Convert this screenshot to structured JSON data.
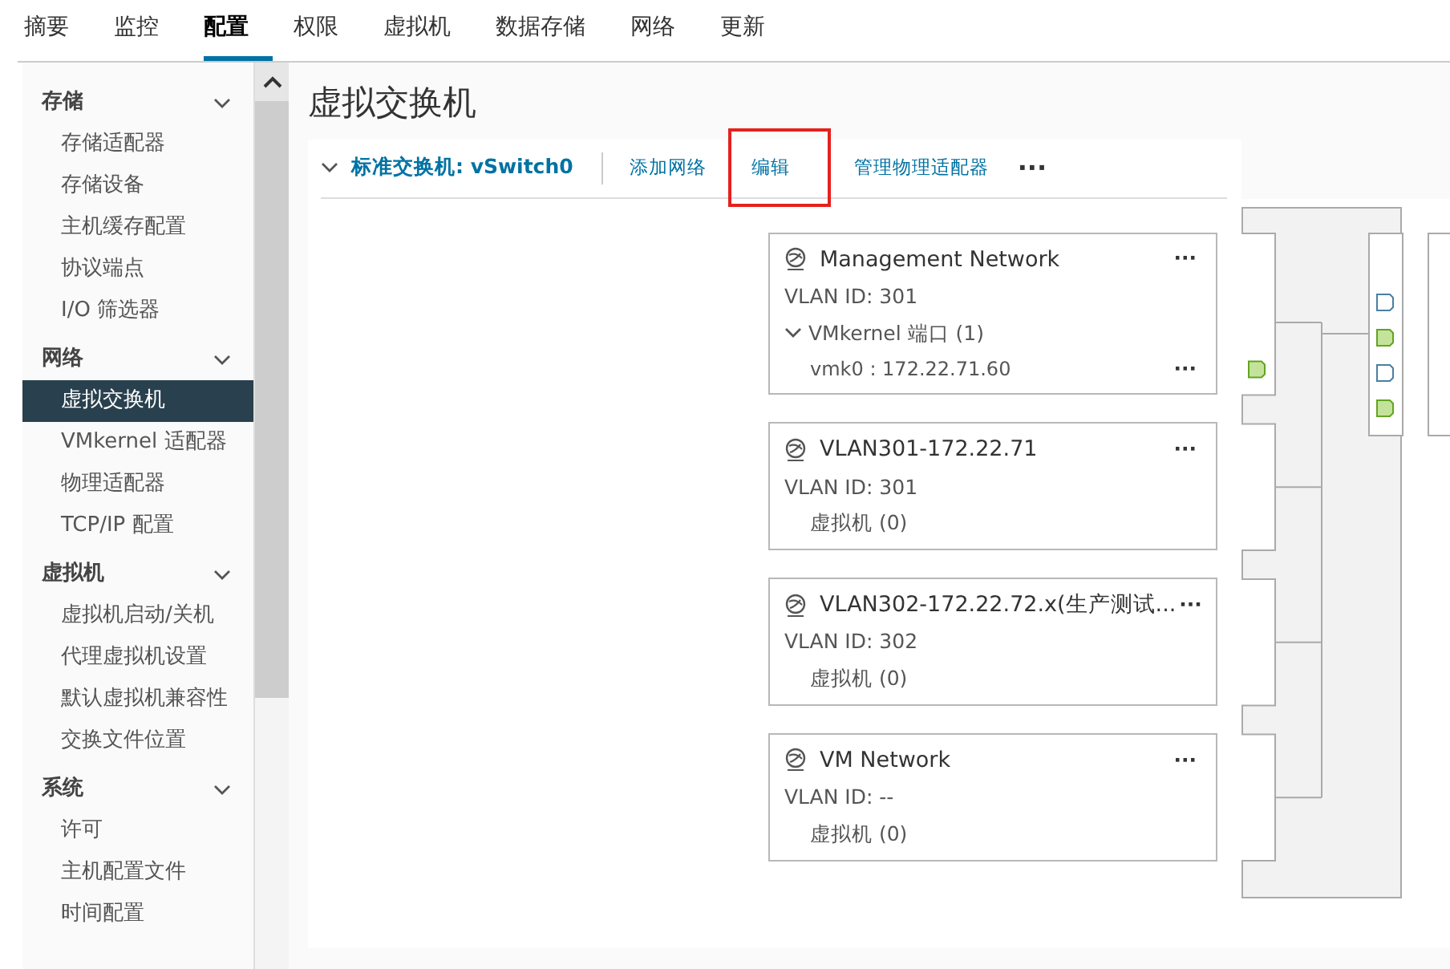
{
  "tabs": [
    {
      "label": "摘要",
      "selected": false
    },
    {
      "label": "监控",
      "selected": false
    },
    {
      "label": "配置",
      "selected": true
    },
    {
      "label": "权限",
      "selected": false
    },
    {
      "label": "虚拟机",
      "selected": false
    },
    {
      "label": "数据存储",
      "selected": false
    },
    {
      "label": "网络",
      "selected": false
    },
    {
      "label": "更新",
      "selected": false
    }
  ],
  "sidebar": {
    "groups": [
      {
        "title": "存储",
        "expanded": true,
        "items": [
          {
            "label": "存储适配器",
            "selected": false
          },
          {
            "label": "存储设备",
            "selected": false
          },
          {
            "label": "主机缓存配置",
            "selected": false
          },
          {
            "label": "协议端点",
            "selected": false
          },
          {
            "label": "I/O 筛选器",
            "selected": false
          }
        ]
      },
      {
        "title": "网络",
        "expanded": true,
        "items": [
          {
            "label": "虚拟交换机",
            "selected": true
          },
          {
            "label": "VMkernel 适配器",
            "selected": false
          },
          {
            "label": "物理适配器",
            "selected": false
          },
          {
            "label": "TCP/IP 配置",
            "selected": false
          }
        ]
      },
      {
        "title": "虚拟机",
        "expanded": true,
        "items": [
          {
            "label": "虚拟机启动/关机",
            "selected": false
          },
          {
            "label": "代理虚拟机设置",
            "selected": false
          },
          {
            "label": "默认虚拟机兼容性",
            "selected": false
          },
          {
            "label": "交换文件位置",
            "selected": false
          }
        ]
      },
      {
        "title": "系统",
        "expanded": true,
        "items": [
          {
            "label": "许可",
            "selected": false
          },
          {
            "label": "主机配置文件",
            "selected": false
          },
          {
            "label": "时间配置",
            "selected": false
          }
        ]
      }
    ]
  },
  "page_title": "虚拟交换机",
  "toolbar": {
    "switch_label": "标准交换机: vSwitch0",
    "expanded": true,
    "actions": [
      {
        "label": "添加网络",
        "highlighted": false
      },
      {
        "label": "编辑",
        "highlighted": true
      },
      {
        "label": "管理物理适配器",
        "highlighted": false
      }
    ],
    "more": "···"
  },
  "port_groups": [
    {
      "name": "Management Network",
      "more": "···",
      "vlan": "VLAN ID: 301",
      "section": {
        "kind": "vmkernel",
        "label": "VMkernel 端口 (1)",
        "expanded": true,
        "items": [
          {
            "text": "vmk0 : 172.22.71.60",
            "more": "···",
            "connected": true
          }
        ]
      }
    },
    {
      "name": "VLAN301-172.22.71",
      "more": "···",
      "vlan": "VLAN ID: 301",
      "section": {
        "kind": "vm",
        "label": "虚拟机 (0)"
      }
    },
    {
      "name": "VLAN302-172.22.72.x(生产测试...",
      "more": "···",
      "vlan": "VLAN ID: 302",
      "section": {
        "kind": "vm",
        "label": "虚拟机 (0)"
      }
    },
    {
      "name": "VM Network",
      "more": "···",
      "vlan": "VLAN ID: --",
      "section": {
        "kind": "vm",
        "label": "虚拟机 (0)"
      }
    }
  ],
  "uplink_ports": [
    {
      "connected": false
    },
    {
      "connected": true
    },
    {
      "connected": false
    },
    {
      "connected": true
    }
  ]
}
